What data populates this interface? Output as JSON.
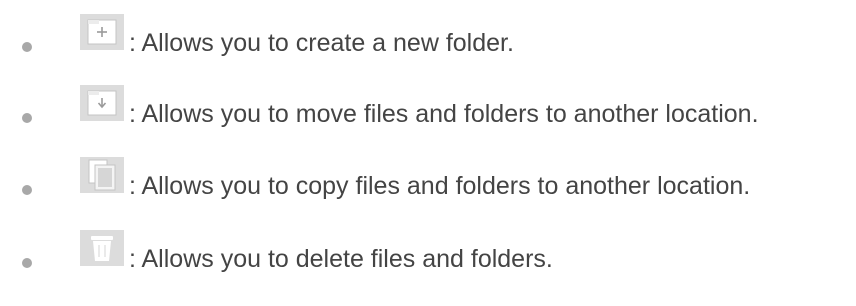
{
  "items": [
    {
      "icon": "new-folder-icon",
      "text": ": Allows you to create a new folder."
    },
    {
      "icon": "move-folder-icon",
      "text": ": Allows you to move files and folders to another location."
    },
    {
      "icon": "copy-icon",
      "text": ": Allows you to copy files and folders to another location."
    },
    {
      "icon": "trash-icon",
      "text": ": Allows you to delete files and folders."
    }
  ],
  "colors": {
    "text": "#444444",
    "bullet": "#a8a8a8",
    "icon_background": "#dcdcdc"
  }
}
